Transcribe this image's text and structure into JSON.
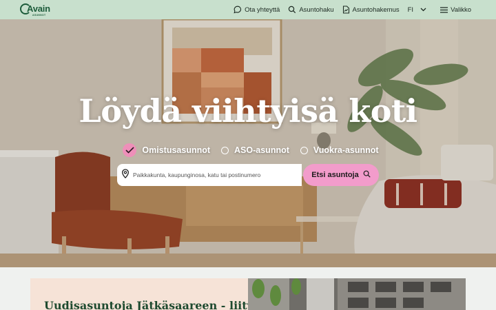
{
  "header": {
    "logo_text": "Avain",
    "logo_sub": "ASUNNOT",
    "nav": {
      "contact": "Ota yhteyttä",
      "search": "Asuntohaku",
      "application": "Asuntohakemus",
      "language": "FI",
      "menu": "Valikko"
    }
  },
  "hero": {
    "title": "Löydä viihtyisä koti",
    "options": [
      {
        "label": "Omistusasunnot",
        "selected": true
      },
      {
        "label": "ASO-asunnot",
        "selected": false
      },
      {
        "label": "Vuokra-asunnot",
        "selected": false
      }
    ],
    "search": {
      "placeholder": "Paikkakunta, kaupunginosa, katu tai postinumero",
      "value": "",
      "button_label": "Etsi asuntoja"
    }
  },
  "promo": {
    "title": "Uudisasuntoja Jätkäsaareen - liity"
  },
  "colors": {
    "header_bg": "#c8e0cd",
    "brand_green": "#1c5b3a",
    "accent_pink": "#f29ccb",
    "promo_bg": "#f6e3d7"
  },
  "icons": [
    "chat-icon",
    "search-icon",
    "document-icon",
    "chevron-down-icon",
    "menu-icon",
    "location-pin-icon",
    "checkmark-icon"
  ]
}
